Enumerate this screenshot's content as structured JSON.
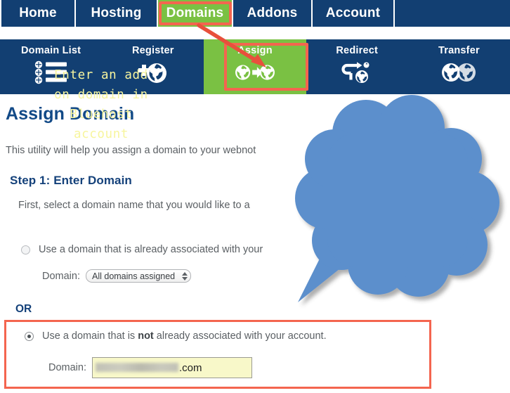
{
  "top_nav": {
    "items": [
      {
        "label": "Home",
        "active": false
      },
      {
        "label": "Hosting",
        "active": false
      },
      {
        "label": "Domains",
        "active": true
      },
      {
        "label": "Addons",
        "active": false
      },
      {
        "label": "Account",
        "active": false
      }
    ]
  },
  "sub_nav": {
    "items": [
      {
        "label": "Domain List",
        "icon": "domain-list-icon",
        "active": false
      },
      {
        "label": "Register",
        "icon": "register-globe-plus-icon",
        "active": false
      },
      {
        "label": "Assign",
        "icon": "assign-globe-arrow-globe-icon",
        "active": true
      },
      {
        "label": "Redirect",
        "icon": "redirect-arrow-globe-icon",
        "active": false
      },
      {
        "label": "Transfer",
        "icon": "transfer-two-globes-icon",
        "active": false
      }
    ]
  },
  "page": {
    "title": "Assign Domain",
    "intro": "This utility will help you assign a domain to your webnot",
    "step_title": "Step 1: Enter Domain",
    "step_desc": "First, select a domain name that you would like to a",
    "or_label": "OR"
  },
  "option_one": {
    "radio_label": "Use a domain that is already associated with your",
    "selected": false,
    "domain_label": "Domain:",
    "select_value": "All domains assigned"
  },
  "option_two": {
    "radio_label_before": "Use a domain that is ",
    "radio_label_bold": "not",
    "radio_label_after": " already associated with your account.",
    "selected": true,
    "domain_label": "Domain:",
    "input_value": ".com",
    "input_redacted": true
  },
  "callout": {
    "text": "Enter an add\non domain in\nBluehost\naccount",
    "bubble_color": "#5b8fcc",
    "text_color": "#f7f59e"
  },
  "annotations": {
    "highlight_color": "#f4654f",
    "arrow_color": "#e8503c",
    "domains_tab_highlighted": true,
    "assign_button_highlighted": true,
    "option_two_highlighted": true
  },
  "colors": {
    "navy": "#123f72",
    "green": "#7ac143",
    "coral": "#f4654f",
    "heading_blue": "#124a87",
    "body_gray": "#5a5f63",
    "input_yellow": "#f8f8c9"
  }
}
